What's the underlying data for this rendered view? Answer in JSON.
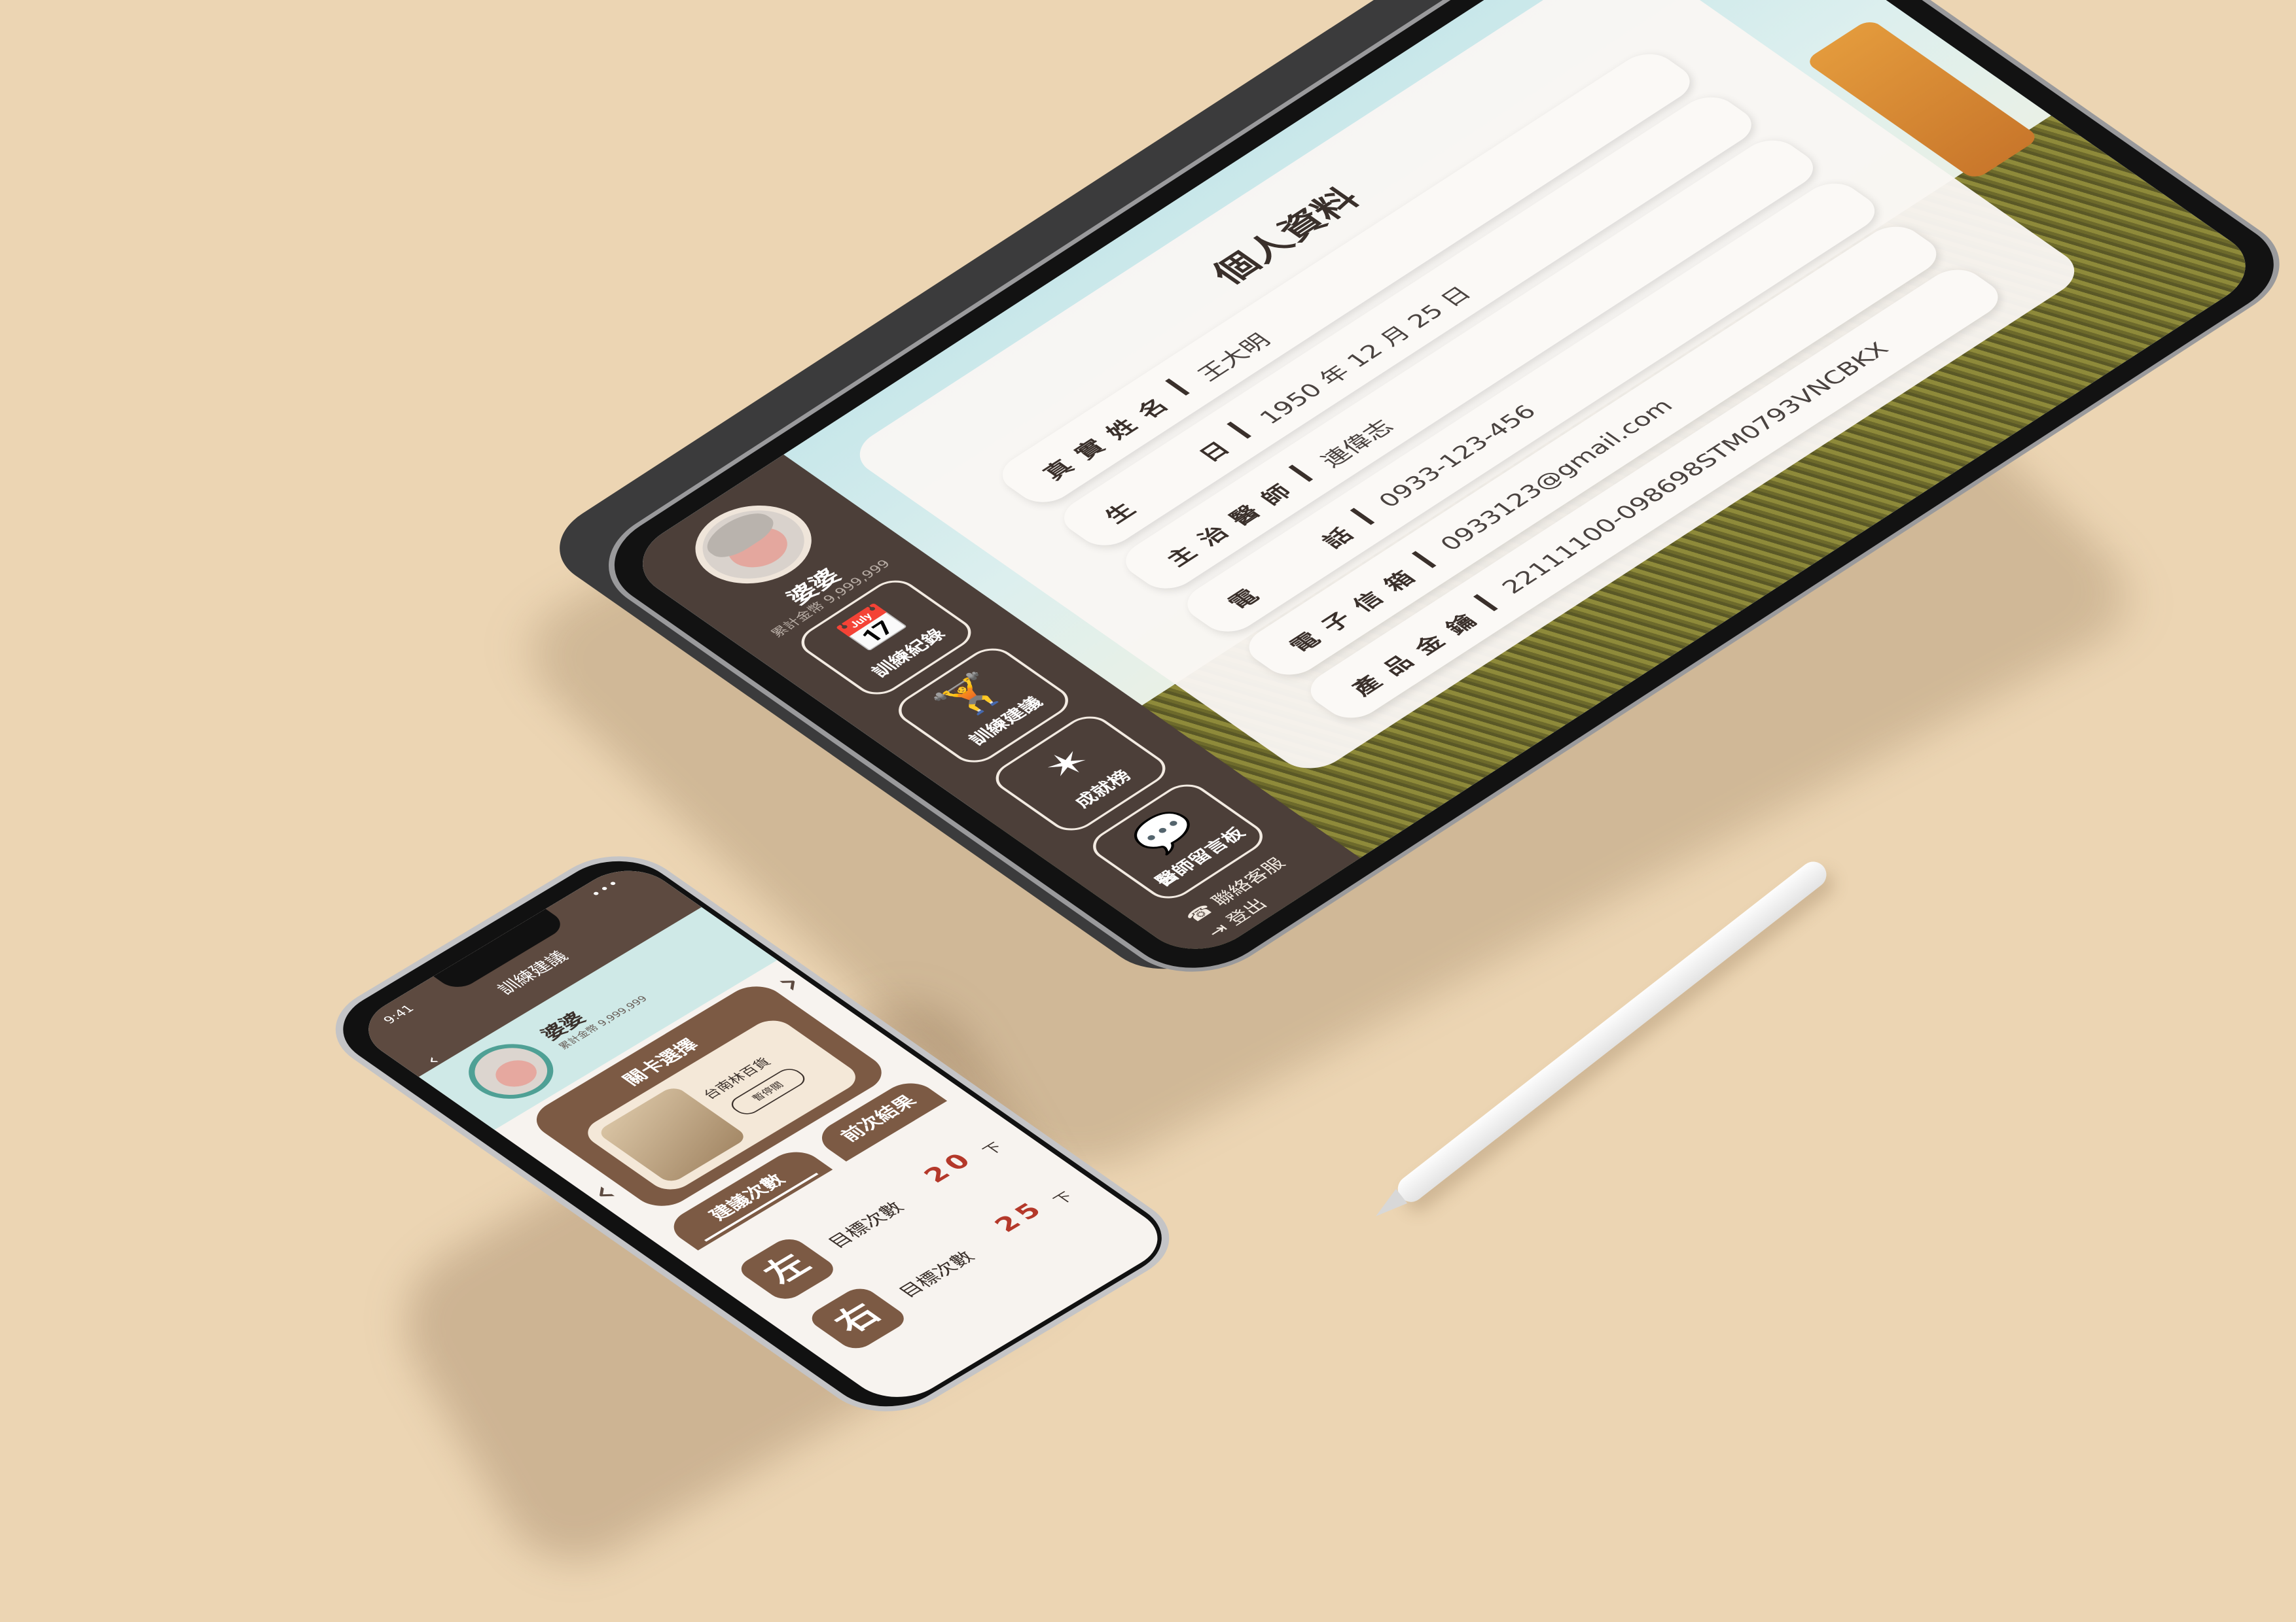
{
  "tablet": {
    "sidebar": {
      "username": "婆婆",
      "points": "累計金幣 9,999,999",
      "nav": [
        {
          "icon": "calendar-icon",
          "glyph": "📅",
          "label": "訓練紀錄"
        },
        {
          "icon": "dumbbell-icon",
          "glyph": "🏋",
          "label": "訓練建議"
        },
        {
          "icon": "star-badge-icon",
          "glyph": "✶",
          "label": "成就榜"
        },
        {
          "icon": "chat-bubble-icon",
          "glyph": "💬",
          "label": "醫師留言板"
        }
      ],
      "contact": "聯絡客服",
      "logout": "登出"
    },
    "profile": {
      "title": "個人資料",
      "fields": [
        {
          "label": "真實姓名",
          "value": "王大明"
        },
        {
          "label": "生日",
          "value": "1950 年 12 月 25 日"
        },
        {
          "label": "主治醫師",
          "value": "連偉志"
        },
        {
          "label": "電話",
          "value": "0933-123-456"
        },
        {
          "label": "電子信箱",
          "value": "0933123@gmail.com"
        },
        {
          "label": "產品金鑰",
          "value": "22111100-098698STM0793VNCBKX"
        }
      ]
    }
  },
  "phone": {
    "status_time": "9:41",
    "status_dots": "•••",
    "title": "訓練建議",
    "back": "‹",
    "username": "婆婆",
    "points": "累計金幣 9,999,999",
    "stage_select_label": "關卡選擇",
    "stage_name": "台南林百貨",
    "stage_button": "暫停關",
    "prev_arrow": "‹",
    "next_arrow": "›",
    "tab_suggest": "建議次數",
    "tab_last": "前次結果",
    "left_label": "左",
    "right_label": "右",
    "target_label": "目標次數",
    "left_target": "20",
    "right_target": "25",
    "unit": "下"
  }
}
